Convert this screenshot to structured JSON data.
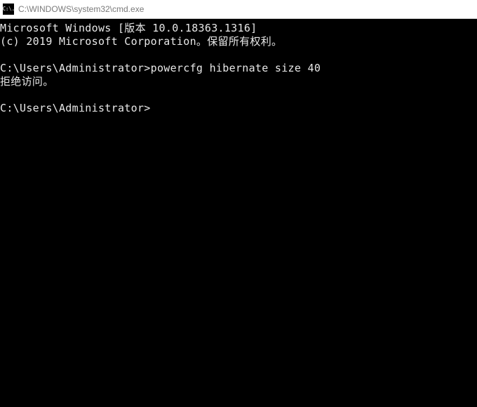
{
  "titlebar": {
    "icon_text": "C:\\.",
    "title": "C:\\WINDOWS\\system32\\cmd.exe"
  },
  "terminal": {
    "header_line1": "Microsoft Windows [版本 10.0.18363.1316]",
    "header_line2": "(c) 2019 Microsoft Corporation。保留所有权利。",
    "prompt1_path": "C:\\Users\\Administrator>",
    "prompt1_command": "powercfg hibernate size 40",
    "output1": "拒绝访问。",
    "prompt2_path": "C:\\Users\\Administrator>",
    "prompt2_command": ""
  }
}
